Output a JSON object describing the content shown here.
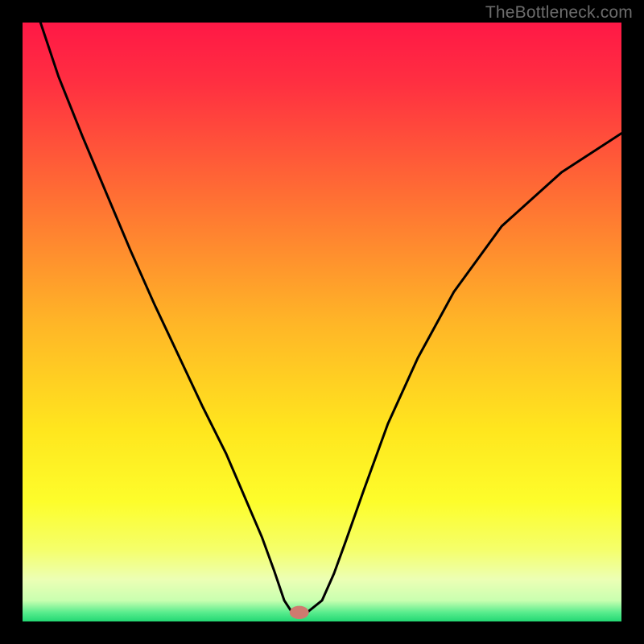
{
  "watermark": "TheBottleneck.com",
  "chart_data": {
    "type": "line",
    "title": "",
    "xlabel": "",
    "ylabel": "",
    "xlim": [
      0,
      100
    ],
    "ylim": [
      0,
      100
    ],
    "background_gradient_stops": [
      {
        "offset": 0.0,
        "color": "#ff1846"
      },
      {
        "offset": 0.1,
        "color": "#ff2f41"
      },
      {
        "offset": 0.3,
        "color": "#ff7233"
      },
      {
        "offset": 0.5,
        "color": "#ffb527"
      },
      {
        "offset": 0.68,
        "color": "#ffe61e"
      },
      {
        "offset": 0.8,
        "color": "#fdfd2b"
      },
      {
        "offset": 0.88,
        "color": "#f5ff6a"
      },
      {
        "offset": 0.93,
        "color": "#ecffb5"
      },
      {
        "offset": 0.965,
        "color": "#c9ffb0"
      },
      {
        "offset": 0.985,
        "color": "#58ec8d"
      },
      {
        "offset": 1.0,
        "color": "#23d873"
      }
    ],
    "series": [
      {
        "name": "bottleneck-curve",
        "stroke": "#000000",
        "stroke_width": 3,
        "x": [
          3,
          6,
          10,
          14,
          18,
          22,
          26,
          30,
          34,
          37,
          40,
          42,
          43.7,
          45,
          47.5,
          50,
          52,
          54,
          57,
          61,
          66,
          72,
          80,
          90,
          100
        ],
        "y": [
          100,
          91,
          81,
          71.5,
          62,
          53,
          44.5,
          36,
          28,
          21,
          14,
          8.5,
          3.5,
          1.5,
          1.5,
          3.5,
          8,
          13.5,
          22,
          33,
          44,
          55,
          66,
          75,
          81.5
        ]
      }
    ],
    "marker": {
      "name": "target-marker",
      "x": 46.2,
      "y": 1.5,
      "rx": 1.6,
      "ry": 1.1,
      "fill": "#cf7a6f"
    }
  }
}
